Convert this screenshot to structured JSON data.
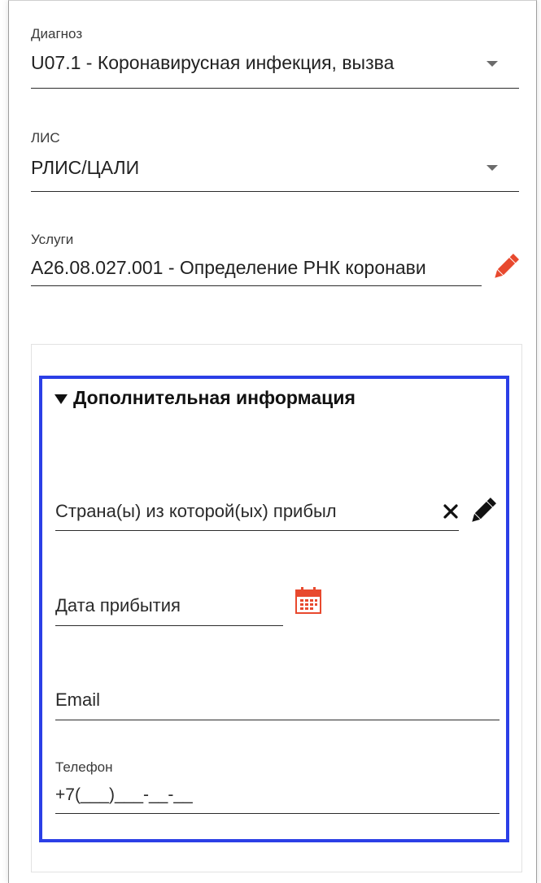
{
  "diagnosis": {
    "label": "Диагноз",
    "value": "U07.1 - Коронавирусная инфекция, вызва"
  },
  "lis": {
    "label": "ЛИС",
    "value": "РЛИС/ЦАЛИ"
  },
  "services": {
    "label": "Услуги",
    "value": "A26.08.027.001 - Определение РНК коронави"
  },
  "additional_info": {
    "title": "Дополнительная информация",
    "country": {
      "placeholder": "Страна(ы) из которой(ых) прибыл"
    },
    "arrival_date": {
      "placeholder": "Дата прибытия"
    },
    "email": {
      "placeholder": "Email"
    },
    "phone": {
      "label": "Телефон",
      "value": "+7(___)___-__-__"
    }
  },
  "colors": {
    "section_border": "#2b3fe6",
    "edit_icon_red": "#e8492e",
    "calendar_red": "#e8492e"
  }
}
